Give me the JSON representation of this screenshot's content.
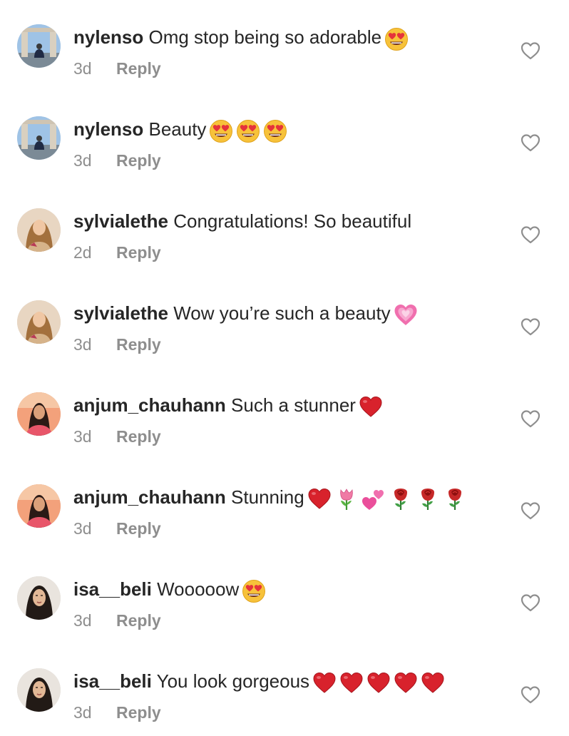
{
  "comments": [
    {
      "username": "nylenso",
      "text": " Omg stop being so adorable",
      "emojis": [
        "heart-eyes-emoji"
      ],
      "time": "3d",
      "reply_label": "Reply",
      "avatar": "avatar-nylenso"
    },
    {
      "username": "nylenso",
      "text": " Beauty",
      "emojis": [
        "heart-eyes-emoji",
        "heart-eyes-emoji",
        "heart-eyes-emoji"
      ],
      "time": "3d",
      "reply_label": "Reply",
      "avatar": "avatar-nylenso"
    },
    {
      "username": "sylvialethe",
      "text": " Congratulations! So beautiful",
      "emojis": [],
      "time": "2d",
      "reply_label": "Reply",
      "avatar": "avatar-sylvialethe"
    },
    {
      "username": "sylvialethe",
      "text": " Wow you’re such a beauty",
      "emojis": [
        "growing-heart-emoji"
      ],
      "time": "3d",
      "reply_label": "Reply",
      "avatar": "avatar-sylvialethe"
    },
    {
      "username": "anjum_chauhann",
      "text": " Such a stunner",
      "emojis": [
        "red-heart-emoji"
      ],
      "time": "3d",
      "reply_label": "Reply",
      "avatar": "avatar-anjum"
    },
    {
      "username": "anjum_chauhann",
      "text": " Stunning",
      "emojis": [
        "red-heart-emoji",
        "tulip-emoji",
        "two-hearts-emoji",
        "rose-emoji",
        "rose-emoji",
        "rose-emoji"
      ],
      "time": "3d",
      "reply_label": "Reply",
      "avatar": "avatar-anjum"
    },
    {
      "username": "isa__beli",
      "text": " Wooooow",
      "emojis": [
        "heart-eyes-emoji"
      ],
      "time": "3d",
      "reply_label": "Reply",
      "avatar": "avatar-isa"
    },
    {
      "username": "isa__beli",
      "text": " You look gorgeous",
      "emojis": [
        "red-heart-emoji",
        "red-heart-emoji",
        "red-heart-emoji",
        "red-heart-emoji",
        "red-heart-emoji"
      ],
      "time": "3d",
      "reply_label": "Reply",
      "avatar": "avatar-isa"
    }
  ],
  "colors": {
    "text": "#262626",
    "meta": "#8e8e8e",
    "like_outline": "#8e8e8e",
    "background": "#ffffff"
  }
}
